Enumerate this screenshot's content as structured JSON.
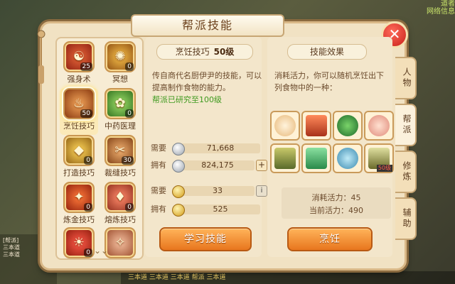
{
  "dialog": {
    "title": "帮派技能",
    "close_label": "✕"
  },
  "background": {
    "top_right_lines": [
      "道者",
      "网络信息"
    ],
    "bottom_left_lines": [
      "[帮派]",
      "三本道",
      "三本道"
    ],
    "chat": "三本道 三本道 三本道 帮派 三本道"
  },
  "skills": [
    {
      "name": "强身术",
      "level": "25",
      "glyph": "☯",
      "color": "#c0392b"
    },
    {
      "name": "冥想",
      "level": "0",
      "glyph": "✺",
      "color": "#d18a1f"
    },
    {
      "name": "烹饪技巧",
      "level": "50",
      "glyph": "♨",
      "color": "#c86c2a",
      "selected": true
    },
    {
      "name": "中药医理",
      "level": "0",
      "glyph": "✿",
      "color": "#4e9a33"
    },
    {
      "name": "打造技巧",
      "level": "0",
      "glyph": "◆",
      "color": "#d69a1e"
    },
    {
      "name": "裁缝技巧",
      "level": "30",
      "glyph": "✂",
      "color": "#b8661e"
    },
    {
      "name": "炼金技巧",
      "level": "0",
      "glyph": "✦",
      "color": "#c1391f"
    },
    {
      "name": "熔炼技巧",
      "level": "0",
      "glyph": "♦",
      "color": "#c84a2a"
    },
    {
      "name": "",
      "level": "0",
      "glyph": "☀",
      "color": "#c0392b"
    },
    {
      "name": "",
      "level": "",
      "glyph": "✧",
      "color": "#c86a3a"
    }
  ],
  "detail": {
    "skill_name": "烹饪技巧",
    "skill_level": "50级",
    "description": "传自商代名厨伊尹的技能，可以提高制作食物的能力。",
    "research_note": "帮派已研究至100级",
    "need_label": "需要",
    "have_label": "拥有",
    "silver_need": "71,668",
    "silver_have": "824,175",
    "gold_need": "33",
    "gold_have": "525",
    "plus_label": "+",
    "info_label": "i",
    "learn_button": "学习技能"
  },
  "effect": {
    "title": "技能效果",
    "description": "消耗活力，你可以随机烹饪出下列食物中的一种：",
    "foods": [
      {
        "name": "包子",
        "color": "#f1d5a6"
      },
      {
        "name": "烤肉",
        "color": "#c94b2a"
      },
      {
        "name": "汤",
        "color": "#3c8e3a"
      },
      {
        "name": "桃",
        "color": "#f6b3a8"
      },
      {
        "name": "酒",
        "color": "#8a8a3a"
      },
      {
        "name": "豆腐",
        "color": "#3ca06a"
      },
      {
        "name": "面",
        "color": "#5ab0d0"
      },
      {
        "name": "佛跳墙",
        "color": "#a0a060",
        "badge": "50级"
      }
    ],
    "cost_text": "消耗活力：45",
    "current_text": "当前活力：490",
    "cook_button": "烹饪"
  },
  "tabs": [
    "人物",
    "帮派",
    "修炼",
    "辅助"
  ]
}
